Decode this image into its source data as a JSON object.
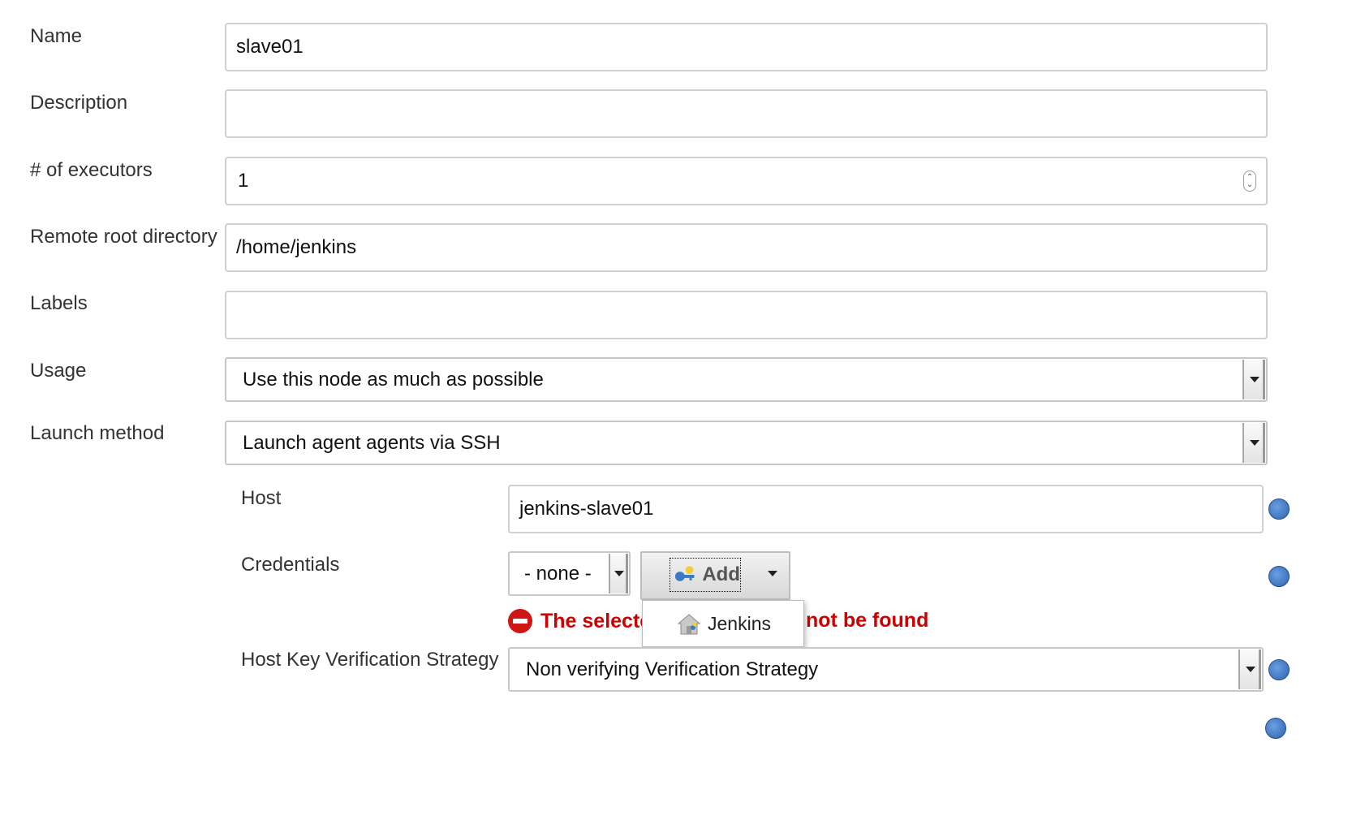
{
  "form": {
    "name": {
      "label": "Name",
      "value": "slave01"
    },
    "description": {
      "label": "Description",
      "value": ""
    },
    "executors": {
      "label": "# of executors",
      "value": "1"
    },
    "remote_root": {
      "label": "Remote root directory",
      "value": "/home/jenkins"
    },
    "labels": {
      "label": "Labels",
      "value": ""
    },
    "usage": {
      "label": "Usage",
      "selected": "Use this node as much as possible"
    },
    "launch_method": {
      "label": "Launch method",
      "selected": "Launch agent agents via SSH"
    }
  },
  "ssh": {
    "host": {
      "label": "Host",
      "value": "jenkins-slave01"
    },
    "credentials": {
      "label": "Credentials",
      "selected": "- none -",
      "add_button_label": "Add",
      "error_prefix": "The selecte",
      "error_suffix": "not be found",
      "dropdown_items": [
        "Jenkins"
      ]
    },
    "host_key": {
      "label": "Host Key Verification Strategy",
      "selected": "Non verifying Verification Strategy"
    }
  },
  "colors": {
    "error": "#cc0000",
    "help_icon": "#2f63b0",
    "border": "#d0d0d0"
  },
  "icons": {
    "help": "help-circle-icon",
    "add_button": "key-icon",
    "error": "no-entry-icon",
    "menu_item": "jenkins-store-icon"
  }
}
